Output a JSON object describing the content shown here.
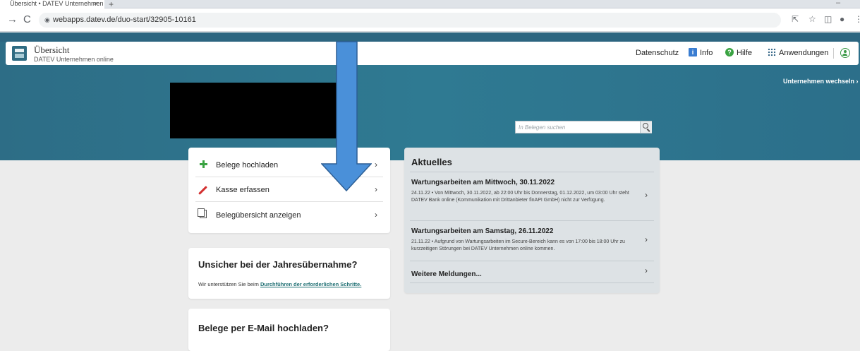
{
  "browser": {
    "tab_title": "Übersicht • DATEV Unternehmen",
    "tab_close": "×",
    "new_tab": "+",
    "window_minimize": "–",
    "back": "→",
    "reload": "C",
    "lock": "🔒",
    "url": "webapps.datev.de/duo-start/32905-10161",
    "icons": [
      "share-icon",
      "star-icon",
      "sidepanel-icon",
      "profile-icon",
      "menu-icon"
    ]
  },
  "header": {
    "title": "Übersicht",
    "subtitle": "DATEV Unternehmen online",
    "nav": {
      "datenschutz": "Datenschutz",
      "info": "Info",
      "hilfe": "Hilfe",
      "anwendungen": "Anwendungen"
    }
  },
  "switch_company": "Unternehmen wechseln",
  "search": {
    "placeholder": "In Belegen suchen"
  },
  "actions": [
    {
      "label": "Belege hochladen",
      "icon": "plus-icon"
    },
    {
      "label": "Kasse erfassen",
      "icon": "pen-icon"
    },
    {
      "label": "Belegübersicht anzeigen",
      "icon": "document-icon"
    }
  ],
  "jahres": {
    "title": "Unsicher bei der Jahresübernahme?",
    "text": "Wir unterstützen Sie beim ",
    "link": "Durchführen der erforderlichen Schritte."
  },
  "email": {
    "title": "Belege per E-Mail hochladen?"
  },
  "news": {
    "heading": "Aktuelles",
    "items": [
      {
        "title": "Wartungsarbeiten am Mittwoch, 30.11.2022",
        "text": "24.11.22 • Von Mittwoch, 30.11.2022, ab 22:00 Uhr bis Donnerstag, 01.12.2022, um 03:00 Uhr steht DATEV Bank online (Kommunikation mit Drittanbieter finAPI GmbH) nicht zur Verfügung."
      },
      {
        "title": "Wartungsarbeiten am Samstag, 26.11.2022",
        "text": "21.11.22 • Aufgrund von Wartungsarbeiten im Secure-Bereich kann es von 17:00 bis 18:00 Uhr zu kurzzeitigen Störungen bei DATEV Unternehmen online kommen."
      }
    ],
    "more": "Weitere Meldungen..."
  },
  "chevron": "›",
  "colors": {
    "header_teal": "#2f7a92",
    "overlay_arrow": "#4a90d9",
    "link": "#1f6f73",
    "news_bg": "#dde2e5"
  }
}
